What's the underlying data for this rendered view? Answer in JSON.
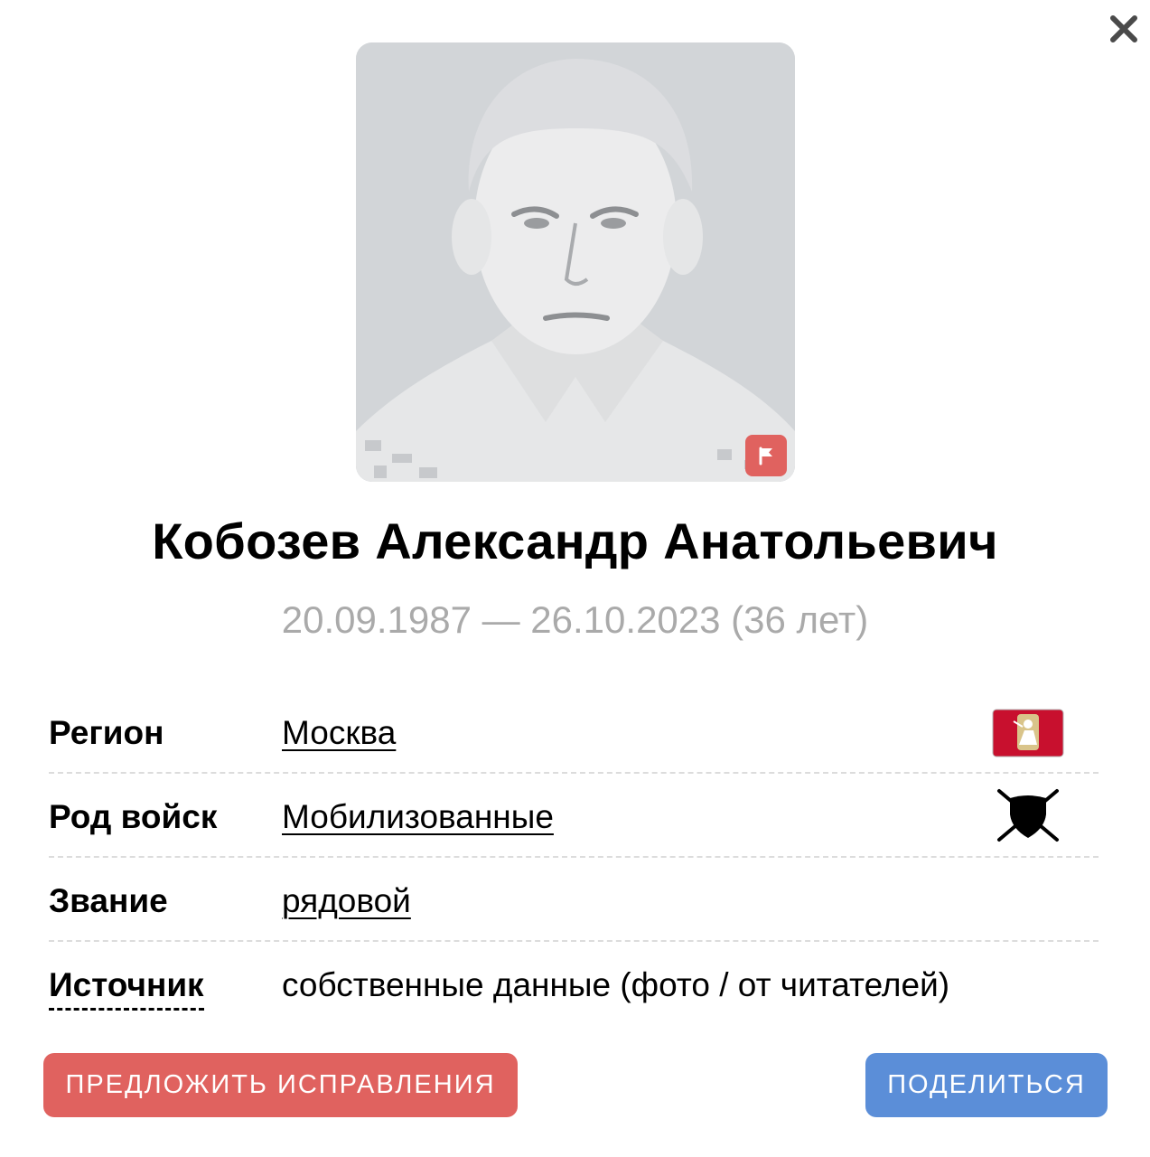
{
  "close": {
    "icon": "close-icon"
  },
  "person": {
    "name": "Кобозев Александр Анатольевич",
    "dates": "20.09.1987 — 26.10.2023 (36 лет)"
  },
  "portrait": {
    "flag_icon": "flag-icon"
  },
  "info": [
    {
      "label": "Регион",
      "value": "Москва",
      "icon": "moscow-flag-icon"
    },
    {
      "label": "Род войск",
      "value": "Мобилизованные",
      "icon": "shield-swords-icon"
    },
    {
      "label": "Звание",
      "value": "рядовой"
    },
    {
      "label": "Источник",
      "value": "собственные данные (фото / от читателей)"
    }
  ],
  "buttons": {
    "suggest": "ПРЕДЛОЖИТЬ ИСПРАВЛЕНИЯ",
    "share": "ПОДЕЛИТЬСЯ"
  },
  "colors": {
    "accent_red": "#e0625f",
    "accent_blue": "#5b8ed8",
    "dates_gray": "#aaaaaa",
    "portrait_bg": "#d2d5d8"
  }
}
